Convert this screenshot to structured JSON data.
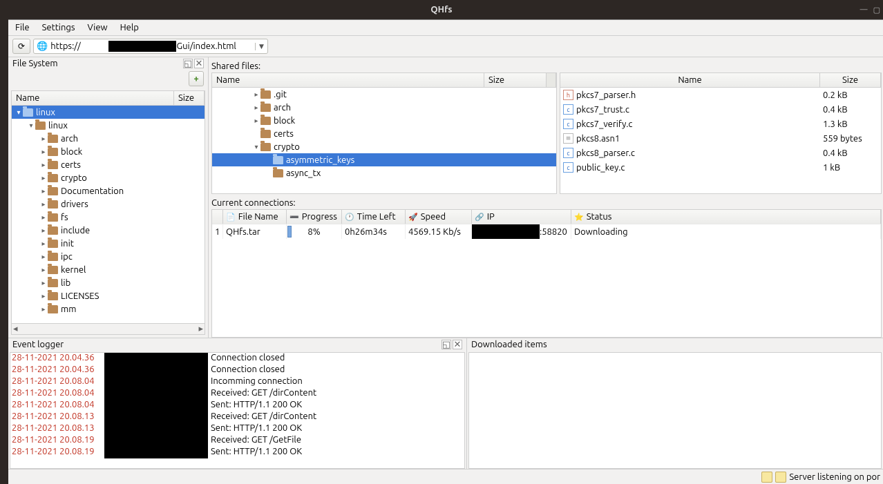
{
  "title": "QHfs",
  "menu": {
    "file": "File",
    "settings": "Settings",
    "view": "View",
    "help": "Help"
  },
  "url": "https://                         :8080/WebGui/index.html",
  "fs": {
    "label": "File System",
    "cols": {
      "name": "Name",
      "size": "Size"
    },
    "root": "linux",
    "root2": "linux",
    "items": [
      "arch",
      "block",
      "certs",
      "crypto",
      "Documentation",
      "drivers",
      "fs",
      "include",
      "init",
      "ipc",
      "kernel",
      "lib",
      "LICENSES",
      "mm"
    ]
  },
  "shared": {
    "label": "Shared files:",
    "cols": {
      "name": "Name",
      "size": "Size"
    },
    "tree": [
      {
        "name": ".git",
        "indent": 3,
        "exp": "▸"
      },
      {
        "name": "arch",
        "indent": 3,
        "exp": "▸"
      },
      {
        "name": "block",
        "indent": 3,
        "exp": "▸"
      },
      {
        "name": "certs",
        "indent": 3,
        "exp": ""
      },
      {
        "name": "crypto",
        "indent": 3,
        "exp": "▾"
      },
      {
        "name": "asymmetric_keys",
        "indent": 4,
        "exp": "",
        "sel": true
      },
      {
        "name": "async_tx",
        "indent": 4,
        "exp": ""
      }
    ],
    "files": [
      {
        "icon": "h",
        "name": "pkcs7_parser.h",
        "size": "0.2 kB"
      },
      {
        "icon": "c",
        "name": "pkcs7_trust.c",
        "size": "0.4 kB"
      },
      {
        "icon": "c",
        "name": "pkcs7_verify.c",
        "size": "1.3 kB"
      },
      {
        "icon": "t",
        "name": "pkcs8.asn1",
        "size": "559 bytes"
      },
      {
        "icon": "c",
        "name": "pkcs8_parser.c",
        "size": "0.4 kB"
      },
      {
        "icon": "c",
        "name": "public_key.c",
        "size": "1 kB"
      }
    ]
  },
  "conn": {
    "label": "Current connections:",
    "cols": {
      "num": "",
      "fn": "File Name",
      "prog": "Progress",
      "tl": "Time Left",
      "spd": "Speed",
      "ip": "IP",
      "st": "Status"
    },
    "row": {
      "n": "1",
      "fn": "QHfs.tar",
      "prog": "8%",
      "progv": 8,
      "tl": "0h26m34s",
      "spd": "4569.15 Kb/s",
      "ipport": ":58820",
      "st": "Downloading"
    }
  },
  "log": {
    "label": "Event logger",
    "entries": [
      {
        "ts": "28-11-2021 20.04.36",
        "msg": "Connection closed"
      },
      {
        "ts": "28-11-2021 20.04.36",
        "msg": "Connection closed"
      },
      {
        "ts": "28-11-2021 20.08.04",
        "msg": "Incomming connection"
      },
      {
        "ts": "28-11-2021 20.08.04",
        "msg": "Received: GET /dirContent"
      },
      {
        "ts": "28-11-2021 20.08.04",
        "msg": "Sent: HTTP/1.1 200 OK"
      },
      {
        "ts": "28-11-2021 20.08.13",
        "msg": "Received: GET /dirContent"
      },
      {
        "ts": "28-11-2021 20.08.13",
        "msg": "Sent: HTTP/1.1 200 OK"
      },
      {
        "ts": "28-11-2021 20.08.19",
        "msg": "Received: GET /GetFile"
      },
      {
        "ts": "28-11-2021 20.08.19",
        "msg": "Sent: HTTP/1.1 200 OK"
      }
    ]
  },
  "dl": {
    "label": "Downloaded items"
  },
  "status": "Server listening on por"
}
